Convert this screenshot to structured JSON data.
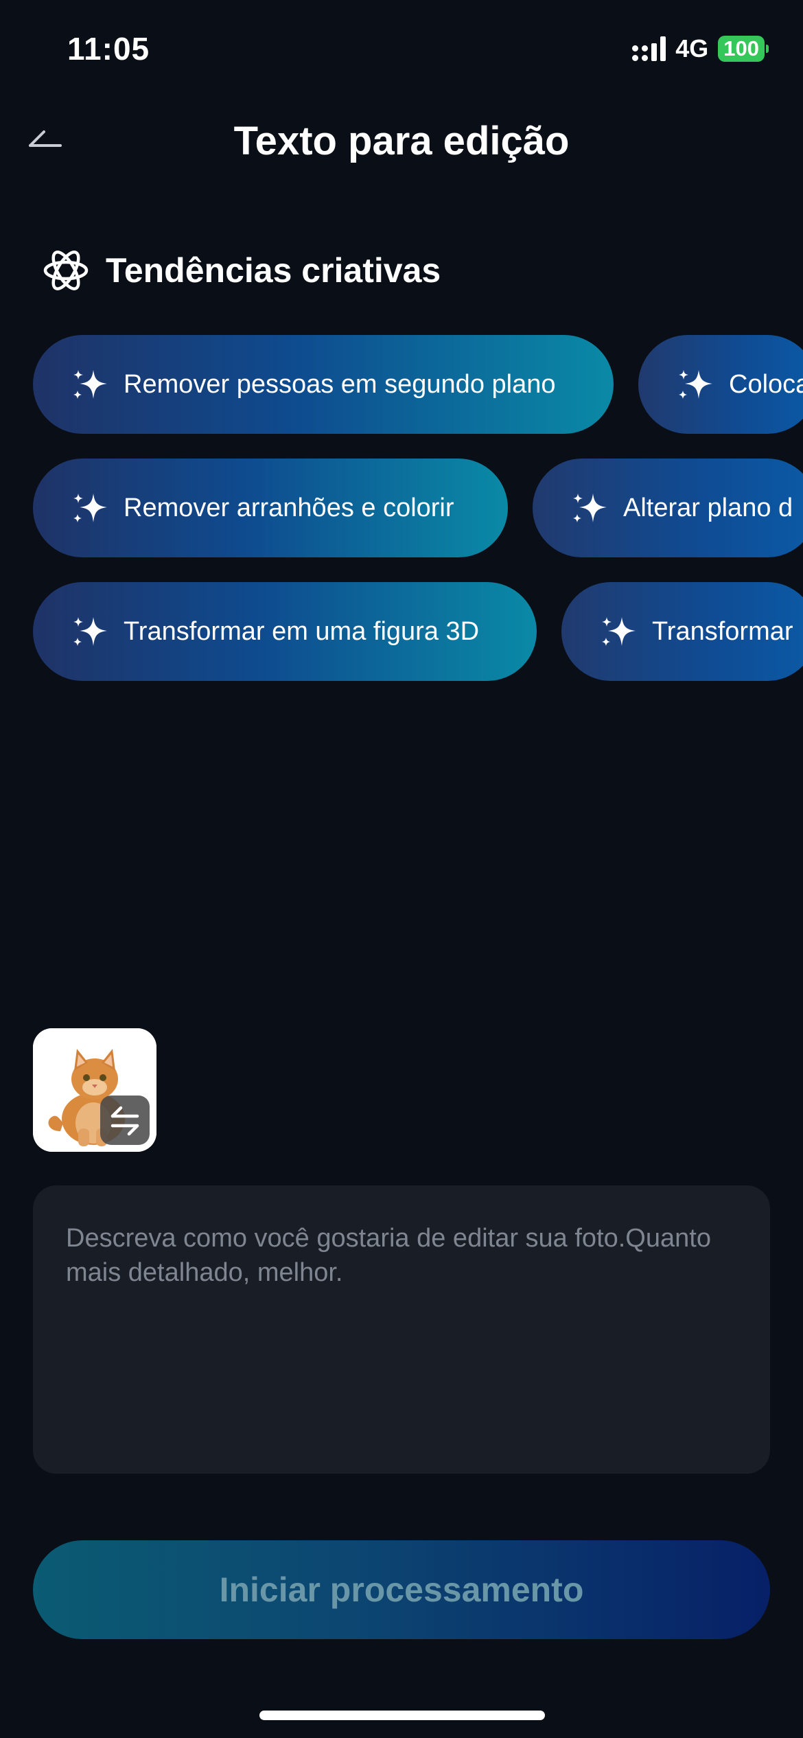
{
  "status_bar": {
    "time": "11:05",
    "network": "4G",
    "battery": "100",
    "battery_color": "#35c759"
  },
  "header": {
    "title": "Texto para edição",
    "back_icon": "back-arrow-icon"
  },
  "section": {
    "title": "Tendências criativas",
    "icon": "atom-icon"
  },
  "chips": [
    {
      "label": "Remover pessoas em segundo plano",
      "icon": "sparkle-icon"
    },
    {
      "label": "Coloca",
      "icon": "sparkle-icon"
    },
    {
      "label": "Remover arranhões e colorir",
      "icon": "sparkle-icon"
    },
    {
      "label": "Alterar plano d",
      "icon": "sparkle-icon"
    },
    {
      "label": "Transformar em uma figura 3D",
      "icon": "sparkle-icon"
    },
    {
      "label": "Transformar",
      "icon": "sparkle-icon"
    }
  ],
  "thumbnail": {
    "subject": "cat-photo",
    "swap_icon": "swap-arrows-icon"
  },
  "prompt": {
    "value": "",
    "placeholder": "Descreva como você gostaria de editar sua foto.Quanto mais detalhado, melhor."
  },
  "start_button": {
    "label": "Iniciar processamento"
  },
  "colors": {
    "background": "#0a0e16",
    "chip_gradient_start": "#1f3367",
    "chip_gradient_end": "#0a8aa6",
    "button_text_disabled": "#6a97a8"
  }
}
